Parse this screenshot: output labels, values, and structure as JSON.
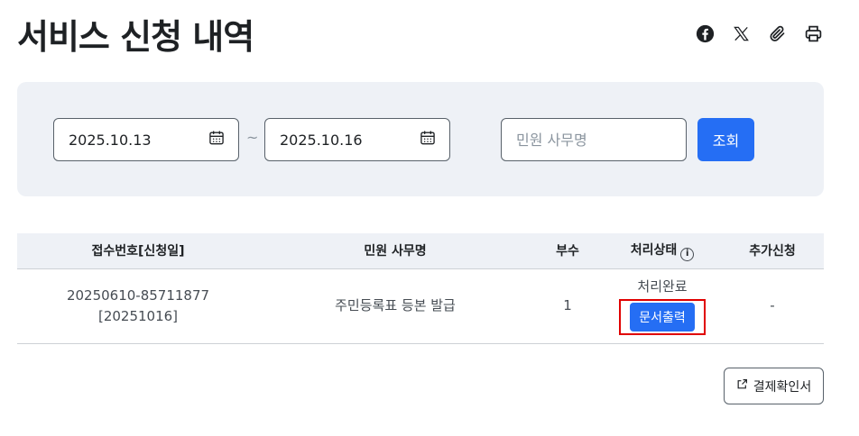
{
  "page": {
    "title": "서비스 신청 내역"
  },
  "share_icons": [
    "facebook-icon",
    "x-icon",
    "attachment-icon",
    "print-icon"
  ],
  "search": {
    "start_date": "2025.10.13",
    "end_date": "2025.10.16",
    "separator": "~",
    "keyword_placeholder": "민원 사무명",
    "search_label": "조회"
  },
  "table": {
    "headers": {
      "receipt": "접수번호[신청일]",
      "name": "민원 사무명",
      "count": "부수",
      "status": "처리상태",
      "additional": "추가신청"
    },
    "rows": [
      {
        "receipt_no": "20250610-85711877",
        "apply_date": "[20251016]",
        "name": "주민등록표 등본 발급",
        "count": "1",
        "status": "처리완료",
        "action_label": "문서출력",
        "additional": "-"
      }
    ]
  },
  "payment_receipt_label": "결제확인서",
  "colors": {
    "primary": "#256ef4",
    "panel": "#eef1f6",
    "highlight": "#e00000"
  }
}
